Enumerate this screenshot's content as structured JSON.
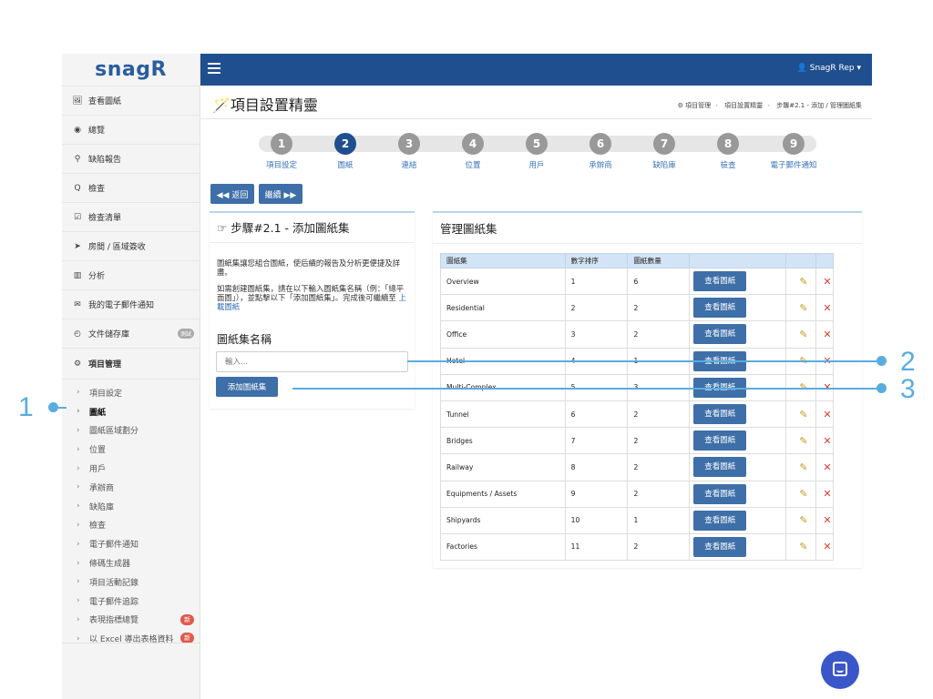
{
  "app": {
    "logo_text": "snagR",
    "user_name": "SnagR Rep ▾"
  },
  "sidebar": {
    "items": [
      {
        "icon": "🖼",
        "label": "查看圖紙"
      },
      {
        "icon": "◉",
        "label": "總覽"
      },
      {
        "icon": "⚲",
        "label": "缺陷報告"
      },
      {
        "icon": "Q",
        "label": "檢查"
      },
      {
        "icon": "☑",
        "label": "檢查清單"
      },
      {
        "icon": "➤",
        "label": "房間 / 區域簽收"
      },
      {
        "icon": "▥",
        "label": "分析"
      },
      {
        "icon": "✉",
        "label": "我的電子郵件通知"
      },
      {
        "icon": "◴",
        "label": "文件儲存庫",
        "badge": "測試"
      }
    ],
    "section": {
      "icon": "⚙",
      "label": "項目管理"
    },
    "sub_items": [
      {
        "label": "項目設定"
      },
      {
        "label": "圖紙"
      },
      {
        "label": "圖紙區域劃分"
      },
      {
        "label": "位置"
      },
      {
        "label": "用戶"
      },
      {
        "label": "承辦商"
      },
      {
        "label": "缺陷庫"
      },
      {
        "label": "檢查"
      },
      {
        "label": "電子郵件通知"
      },
      {
        "label": "條碼生成器"
      },
      {
        "label": "項目活動記錄"
      },
      {
        "label": "電子郵件追踪"
      },
      {
        "label": "表現指標總覽",
        "badge": "新"
      },
      {
        "label": "以 Excel 導出表格資料",
        "badge": "新"
      }
    ]
  },
  "header": {
    "title": "項目設置精靈",
    "breadcrumb": [
      "項目管理",
      "項目設置精靈",
      "步驟#2.1 - 添加 / 管理圖紙集"
    ]
  },
  "steps": [
    {
      "num": "1",
      "label": "項目設定"
    },
    {
      "num": "2",
      "label": "圖紙"
    },
    {
      "num": "3",
      "label": "連結"
    },
    {
      "num": "4",
      "label": "位置"
    },
    {
      "num": "5",
      "label": "用戶"
    },
    {
      "num": "6",
      "label": "承辦商"
    },
    {
      "num": "7",
      "label": "缺陷庫"
    },
    {
      "num": "8",
      "label": "檢查"
    },
    {
      "num": "9",
      "label": "電子郵件通知"
    }
  ],
  "nav_buttons": {
    "back": "◀◀ 返回",
    "next": "繼續 ▶▶"
  },
  "left_panel": {
    "title": "步驟#2.1 - 添加圖紙集",
    "desc1": "圖紙集讓您組合圖紙，使后續的報告及分析更便捷及詳盡。",
    "desc2": "如需創建圖紙集，請在以下輸入圖紙集名稱（例：「總平面圖」），並點擊以下「添加圖紙集」。完成後可繼續至",
    "desc2_link": "上載圖紙",
    "field_label": "圖紙集名稱",
    "input_placeholder": "輸入...",
    "add_button": "添加圖紙集"
  },
  "right_panel": {
    "title": "管理圖紙集",
    "columns": [
      "圖紙集",
      "數字排序",
      "圖紙數量",
      "",
      "",
      ""
    ],
    "view_label": "查看圖紙",
    "rows": [
      {
        "name": "Overview",
        "order": "1",
        "count": "6"
      },
      {
        "name": "Residential",
        "order": "2",
        "count": "2"
      },
      {
        "name": "Office",
        "order": "3",
        "count": "2"
      },
      {
        "name": "Hotel",
        "order": "4",
        "count": "1"
      },
      {
        "name": "Multi-Complex",
        "order": "5",
        "count": "3"
      },
      {
        "name": "Tunnel",
        "order": "6",
        "count": "2"
      },
      {
        "name": "Bridges",
        "order": "7",
        "count": "2"
      },
      {
        "name": "Railway",
        "order": "8",
        "count": "2"
      },
      {
        "name": "Equipments / Assets",
        "order": "9",
        "count": "2"
      },
      {
        "name": "Shipyards",
        "order": "10",
        "count": "1"
      },
      {
        "name": "Factories",
        "order": "11",
        "count": "2"
      }
    ]
  },
  "callouts": [
    "1",
    "2",
    "3"
  ],
  "colors": {
    "primary": "#1f4f8f",
    "button": "#3e6fa8",
    "callout": "#5aacdf",
    "link": "#2f6fb5"
  }
}
